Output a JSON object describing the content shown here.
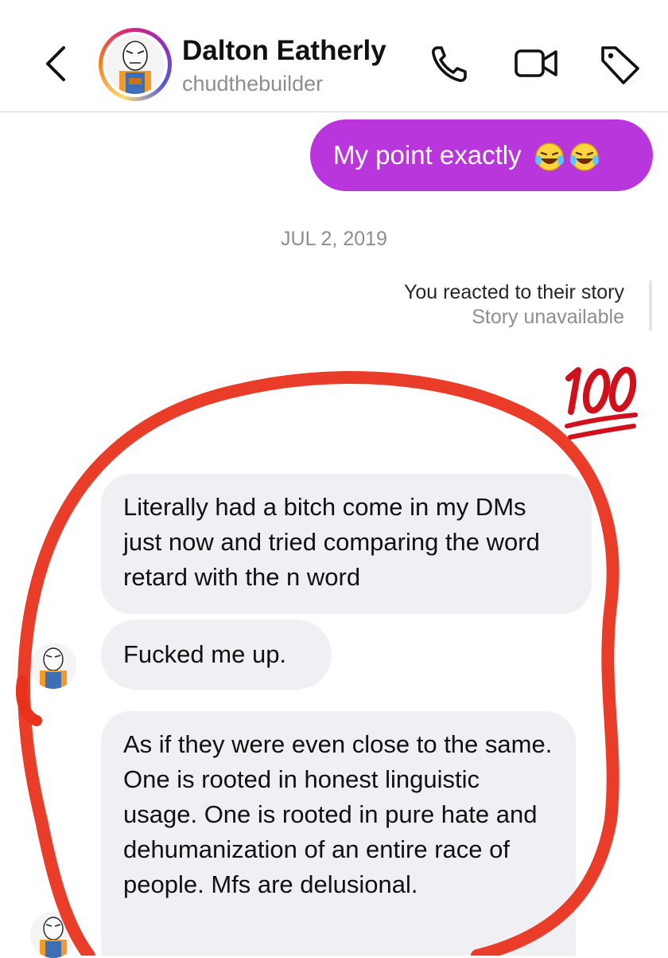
{
  "header": {
    "contact_name": "Dalton Eatherly",
    "username": "chudthebuilder",
    "icons": {
      "back": "chevron-left-icon",
      "call": "phone-icon",
      "video": "video-camera-icon",
      "tag": "tag-icon"
    }
  },
  "thread": {
    "sent_message": {
      "text": "My point exactly",
      "emoji": "face-with-tears-of-joy x2"
    },
    "date_separator": "JUL 2, 2019",
    "story_reaction": {
      "title": "You reacted to their story",
      "subtitle": "Story unavailable",
      "reaction_emoji": "hundred-points"
    },
    "received_messages": [
      {
        "text": "Literally had a bitch come in my DMs just now and tried comparing the word retard with the n word"
      },
      {
        "text": "Fucked me up."
      },
      {
        "text": "As if they were even close to the same. One is rooted in honest linguistic usage. One is rooted in pure hate and dehumanization of an entire race of people. Mfs are delusional."
      }
    ]
  },
  "colors": {
    "sent_bubble": "#b936dc",
    "received_bubble": "#efeff4",
    "annotation_red": "#e8321e",
    "muted_text": "#8e8e8e",
    "reaction_red": "#d0101c"
  }
}
